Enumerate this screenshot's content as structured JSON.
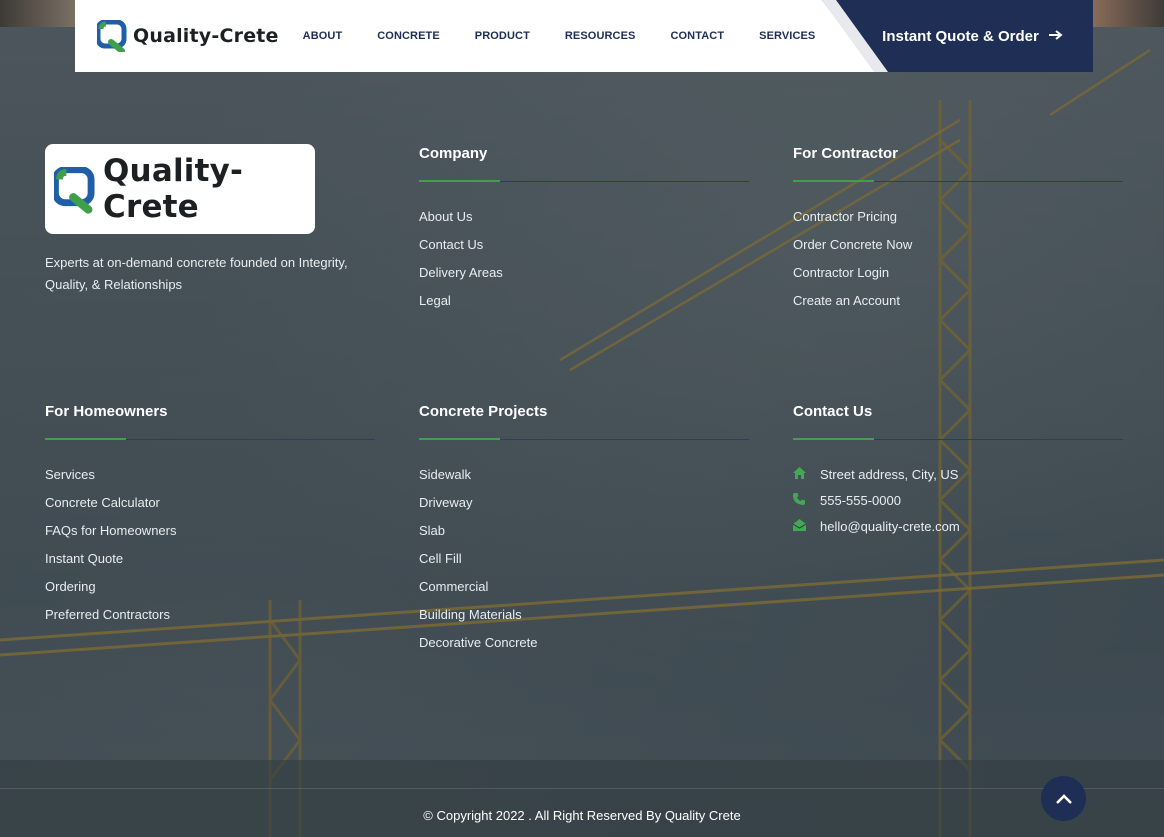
{
  "header": {
    "logo_text": "Quality-Crete",
    "nav": [
      "ABOUT",
      "CONCRETE",
      "PRODUCT",
      "RESOURCES",
      "CONTACT",
      "SERVICES"
    ],
    "cta_label": "Instant Quote & Order",
    "cta_icon": "arrow-right-icon"
  },
  "brand": {
    "logo_text": "Quality-Crete",
    "tagline": "Experts at on-demand concrete founded on Integrity, Quality, & Relationships"
  },
  "columns": {
    "company": {
      "title": "Company",
      "links": [
        "About Us",
        "Contact Us",
        "Delivery Areas",
        "Legal"
      ]
    },
    "contractor": {
      "title": "For Contractor",
      "links": [
        "Contractor Pricing",
        "Order Concrete Now",
        "Contractor Login",
        "Create an Account"
      ]
    },
    "homeowners": {
      "title": "For Homeowners",
      "links": [
        "Services",
        "Concrete Calculator",
        "FAQs for Homeowners",
        "Instant Quote",
        "Ordering",
        "Preferred Contractors"
      ]
    },
    "projects": {
      "title": "Concrete Projects",
      "links": [
        "Sidewalk",
        "Driveway",
        "Slab",
        "Cell Fill",
        "Commercial",
        "Building Materials",
        "Decorative Concrete"
      ]
    },
    "contact": {
      "title": "Contact Us",
      "items": [
        {
          "icon": "home-icon",
          "text": "Street address, City, US"
        },
        {
          "icon": "phone-icon",
          "text": "555-555-0000"
        },
        {
          "icon": "envelope-icon",
          "text": "hello@quality-crete.com"
        }
      ]
    }
  },
  "footer": {
    "copyright": "© Copyright 2022 . All Right Reserved By Quality Crete",
    "scroll_top_icon": "chevron-up-icon"
  },
  "colors": {
    "brand_navy": "#1e2e55",
    "brand_green": "#3f9f4a",
    "brand_blue": "#1f5fa8"
  }
}
